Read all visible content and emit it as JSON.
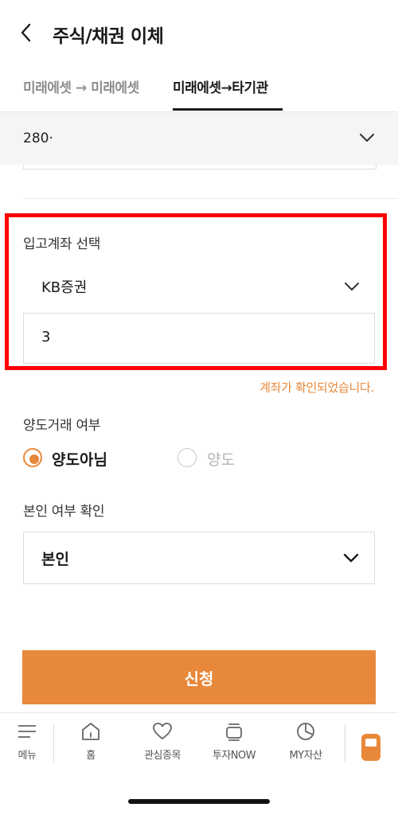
{
  "header": {
    "title": "주식/채권 이체",
    "back_icon": "chevron-left-icon"
  },
  "tabs": [
    {
      "label": "미래에셋 → 미래에셋",
      "active": false
    },
    {
      "label": "미래에셋→타기관",
      "active": true
    }
  ],
  "source_account": {
    "value": "280·",
    "icon": "chevron-down-icon"
  },
  "deposit_account": {
    "label": "입고계좌 선택",
    "bank": "KB증권",
    "account_number": "3",
    "confirm_message": "계좌가 확인되었습니다."
  },
  "transfer_type": {
    "label": "양도거래 여부",
    "options": [
      {
        "label": "양도아님",
        "selected": true
      },
      {
        "label": "양도",
        "selected": false
      }
    ]
  },
  "identity": {
    "label": "본인 여부 확인",
    "value": "본인"
  },
  "submit": {
    "label": "신청"
  },
  "bottom_nav": {
    "items": [
      {
        "label": "메뉴",
        "icon": "menu-icon"
      },
      {
        "label": "홈",
        "icon": "home-icon"
      },
      {
        "label": "관심종목",
        "icon": "heart-icon"
      },
      {
        "label": "투자NOW",
        "icon": "stack-icon"
      },
      {
        "label": "MY자산",
        "icon": "pie-chart-icon"
      }
    ],
    "app_button_icon": "phone-icon"
  },
  "colors": {
    "accent": "#e8883a",
    "highlight": "#ff0000",
    "text": "#1a1a1a",
    "muted": "#8c8c8c"
  }
}
